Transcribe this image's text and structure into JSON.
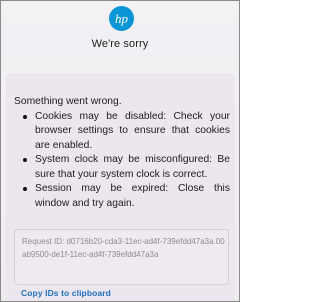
{
  "brand": {
    "logo_icon": "hp-logo",
    "color": "#0a96d6"
  },
  "header": {
    "title": "We're sorry"
  },
  "error": {
    "heading": "Something went wrong.",
    "bullets": [
      {
        "text": "Cookies may be disabled: Check your browser settings to ensure that cookies are enabled."
      },
      {
        "text": "System clock may be misconfigured: Be sure that your system clock is correct."
      },
      {
        "text": "Session may be expired: Close this window and try again."
      }
    ]
  },
  "request": {
    "text": "Request ID: d0716b20-cda3-11ec-ad4f-739efdd47a3a.00ab9500-de1f-11ec-ad4f-739efdd47a3a"
  },
  "actions": {
    "copy_label": "Copy IDs to clipboard",
    "link_color": "#1e6fc0"
  }
}
